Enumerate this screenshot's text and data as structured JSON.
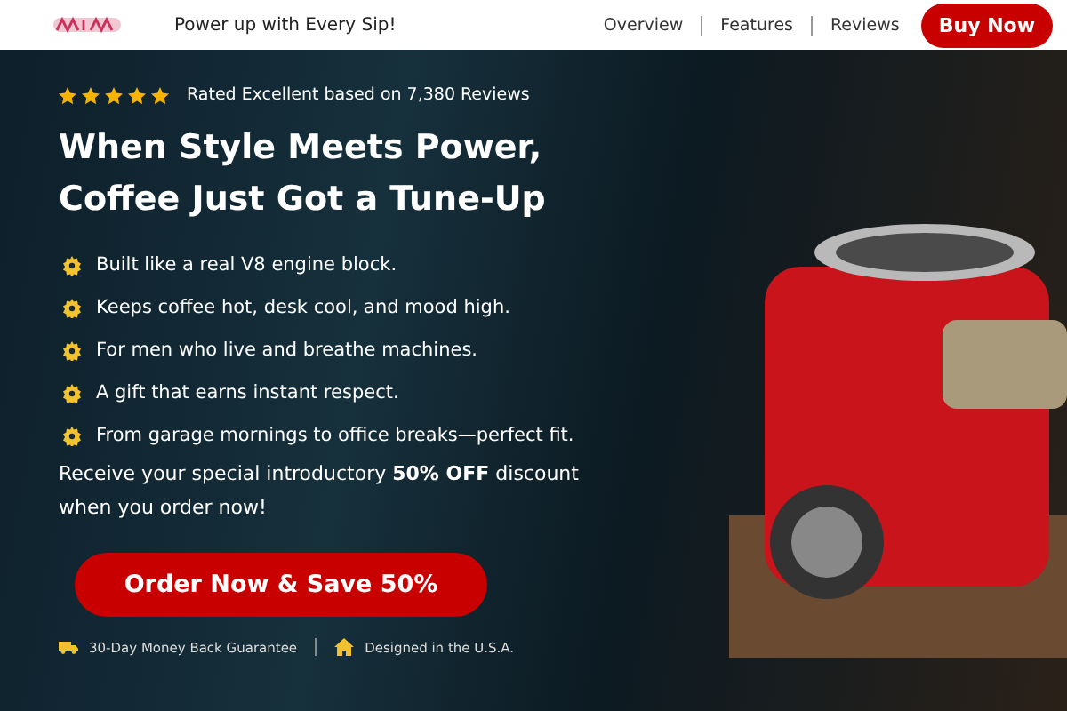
{
  "header": {
    "tagline": "Power up with Every Sip!",
    "nav": [
      {
        "label": "Overview"
      },
      {
        "label": "Features"
      },
      {
        "label": "Reviews"
      }
    ],
    "cta": "Buy Now"
  },
  "hero": {
    "rating": {
      "stars": 5,
      "text": "Rated Excellent based on 7,380 Reviews"
    },
    "headline": [
      "When Style Meets Power,",
      "Coffee Just Got a Tune-Up"
    ],
    "bullets": [
      "Built like a real V8 engine block.",
      "Keeps coffee hot, desk cool, and mood high.",
      "For men who live and breathe machines.",
      "A gift that earns instant respect.",
      "From garage mornings to office breaks—perfect fit."
    ],
    "offer": "Receive your special introductory **50% OFF** discount when you order now!",
    "button": "Order Now & Save 50%",
    "badges": [
      {
        "kind": "truck",
        "text": "30-Day Money Back Guarantee"
      },
      {
        "kind": "home",
        "text": "Designed in the U.S.A."
      }
    ]
  }
}
